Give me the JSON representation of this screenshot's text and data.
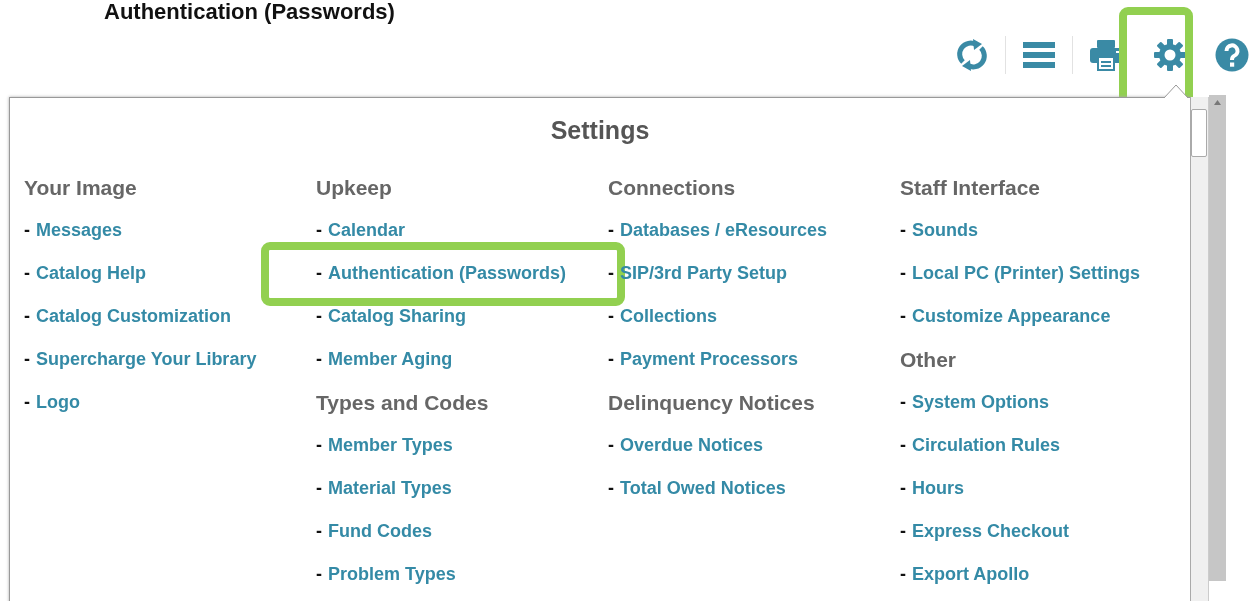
{
  "page_heading": "Authentication (Passwords)",
  "toolbar": [
    {
      "kind": "refresh",
      "highlighted": false
    },
    {
      "kind": "menu",
      "highlighted": false
    },
    {
      "kind": "print",
      "highlighted": false
    },
    {
      "kind": "settings",
      "highlighted": true
    },
    {
      "kind": "help",
      "highlighted": false
    }
  ],
  "settings": {
    "title": "Settings",
    "columns": [
      {
        "sections": [
          {
            "heading": "Your Image",
            "items": [
              {
                "bullet": "-",
                "label": "Messages",
                "highlighted": false
              },
              {
                "bullet": "-",
                "label": "Catalog Help",
                "highlighted": false
              },
              {
                "bullet": "-",
                "label": "Catalog Customization",
                "highlighted": false
              },
              {
                "bullet": "-",
                "label": "Supercharge Your Library",
                "highlighted": false
              },
              {
                "bullet": "-",
                "label": "Logo",
                "highlighted": false
              }
            ]
          }
        ]
      },
      {
        "sections": [
          {
            "heading": "Upkeep",
            "items": [
              {
                "bullet": "-",
                "label": "Calendar",
                "highlighted": false
              },
              {
                "bullet": "-",
                "label": "Authentication (Passwords)",
                "highlighted": true
              },
              {
                "bullet": "-",
                "label": "Catalog Sharing",
                "highlighted": false
              },
              {
                "bullet": "-",
                "label": "Member Aging",
                "highlighted": false
              }
            ]
          },
          {
            "heading": "Types and Codes",
            "items": [
              {
                "bullet": "-",
                "label": "Member Types",
                "highlighted": false
              },
              {
                "bullet": "-",
                "label": "Material Types",
                "highlighted": false
              },
              {
                "bullet": "-",
                "label": "Fund Codes",
                "highlighted": false
              },
              {
                "bullet": "-",
                "label": "Problem Types",
                "highlighted": false
              }
            ]
          }
        ]
      },
      {
        "sections": [
          {
            "heading": "Connections",
            "items": [
              {
                "bullet": "-",
                "label": "Databases / eResources",
                "highlighted": false
              },
              {
                "bullet": "-",
                "label": "SIP/3rd Party Setup",
                "highlighted": false
              },
              {
                "bullet": "-",
                "label": "Collections",
                "highlighted": false
              },
              {
                "bullet": "-",
                "label": "Payment Processors",
                "highlighted": false
              }
            ]
          },
          {
            "heading": "Delinquency Notices",
            "items": [
              {
                "bullet": "-",
                "label": "Overdue Notices",
                "highlighted": false
              },
              {
                "bullet": "-",
                "label": "Total Owed Notices",
                "highlighted": false
              }
            ]
          }
        ]
      },
      {
        "sections": [
          {
            "heading": "Staff Interface",
            "items": [
              {
                "bullet": "-",
                "label": "Sounds",
                "highlighted": false
              },
              {
                "bullet": "-",
                "label": "Local PC (Printer) Settings",
                "highlighted": false
              },
              {
                "bullet": "-",
                "label": "Customize Appearance",
                "highlighted": false
              }
            ]
          },
          {
            "heading": "Other",
            "items": [
              {
                "bullet": "-",
                "label": "System Options",
                "highlighted": false
              },
              {
                "bullet": "-",
                "label": "Circulation Rules",
                "highlighted": false
              },
              {
                "bullet": "-",
                "label": "Hours",
                "highlighted": false
              },
              {
                "bullet": "-",
                "label": "Express Checkout",
                "highlighted": false
              },
              {
                "bullet": "-",
                "label": "Export Apollo",
                "highlighted": false
              }
            ]
          }
        ]
      }
    ]
  }
}
